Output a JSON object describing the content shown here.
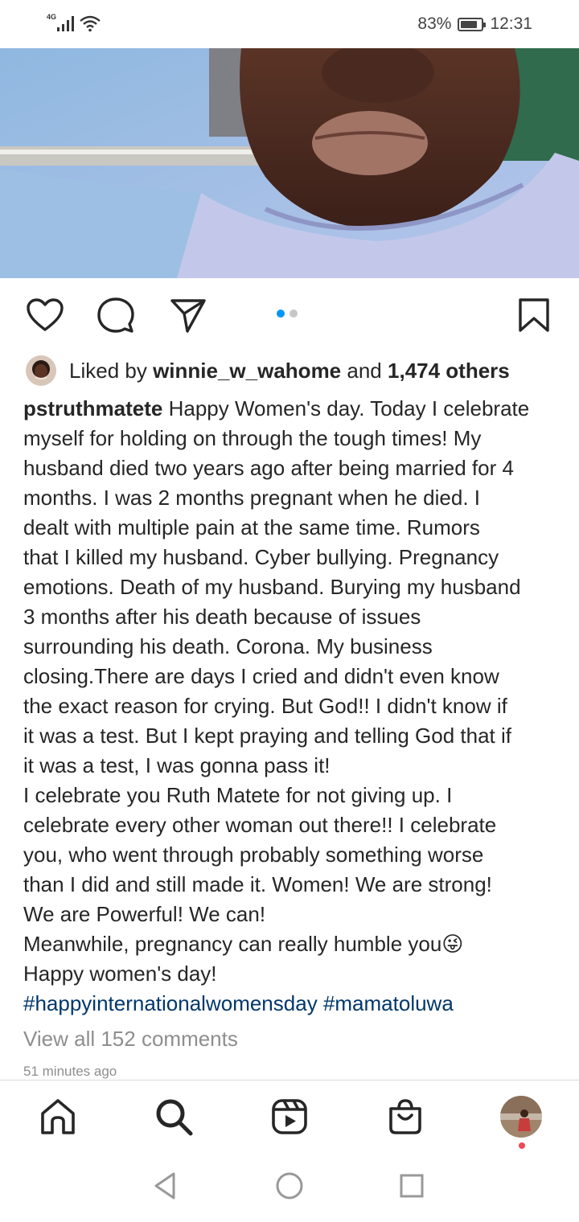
{
  "status_bar": {
    "network": "4G",
    "battery_percent": "83%",
    "battery_level": 0.83,
    "time": "12:31"
  },
  "post": {
    "carousel": {
      "count": 2,
      "active_index": 0
    },
    "likes": {
      "prefix": "Liked by",
      "user": "winnie_w_wahome",
      "middle": "and",
      "others": "1,474 others"
    },
    "caption": {
      "username": "pstruthmatete",
      "lines": [
        " Happy Women's day. Today I celebrate",
        "myself for holding on through the tough times! My",
        "husband died two years ago after being married for 4",
        "months. I was 2 months pregnant when he died. I",
        "dealt with multiple pain at the same time. Rumors",
        "that I killed my husband. Cyber bullying. Pregnancy",
        "emotions. Death of my husband. Burying my husband",
        "3 months after his death because of issues",
        "surrounding his death. Corona. My business",
        "closing.There are days I cried and didn't even know",
        "the exact reason for crying. But God!! I didn't know if",
        "it was a test. But I kept praying and telling God that if",
        "it was a test, I was gonna pass it!",
        "I celebrate you Ruth Matete for not giving up.  I",
        "celebrate every other woman out there!! I celebrate",
        "you, who went through probably something worse",
        "than I did and still made it. Women! We are strong!",
        "We are Powerful! We can!",
        "Meanwhile, pregnancy can really humble you😜",
        "Happy women's day!"
      ],
      "hashtags": [
        "#happyinternationalwomensday",
        "#mamatoluwa"
      ]
    },
    "view_comments": "View all 152 comments",
    "timestamp": "51 minutes ago"
  },
  "icons": {
    "actions": [
      "heart-icon",
      "comment-icon",
      "share-icon",
      "bookmark-icon"
    ],
    "nav": [
      "home-icon",
      "search-icon",
      "reels-icon",
      "shop-icon",
      "profile-avatar"
    ],
    "system": [
      "back-icon",
      "home-circle-icon",
      "recents-icon"
    ]
  },
  "colors": {
    "link_blue": "#00376b",
    "carousel_active": "#0095f6",
    "secondary_text": "#8e8e8e",
    "notification": "#ed4956"
  }
}
